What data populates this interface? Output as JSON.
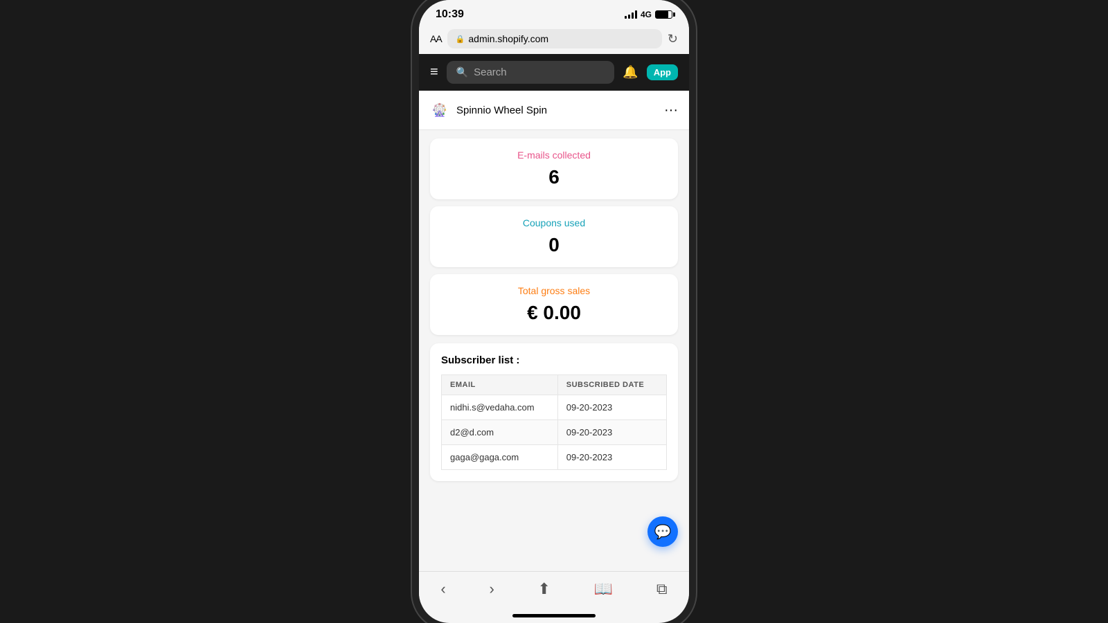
{
  "status_bar": {
    "time": "10:39",
    "network": "4G"
  },
  "browser": {
    "aa_label": "AA",
    "url": "admin.shopify.com",
    "lock_symbol": "🔒"
  },
  "nav": {
    "search_placeholder": "Search",
    "app_badge": "App"
  },
  "app": {
    "name": "Spinnio Wheel Spin",
    "more_dots": "···"
  },
  "stats": {
    "emails_label": "E-mails collected",
    "emails_value": "6",
    "coupons_label": "Coupons used",
    "coupons_value": "0",
    "sales_label": "Total gross sales",
    "sales_value": "€ 0.00"
  },
  "subscribers": {
    "section_title": "Subscriber list :",
    "table": {
      "col_email": "EMAIL",
      "col_date": "SUBSCRIBED DATE",
      "rows": [
        {
          "email": "nidhi.s@vedaha.com",
          "date": "09-20-2023"
        },
        {
          "email": "d2@d.com",
          "date": "09-20-2023"
        },
        {
          "email": "gaga@gaga.com",
          "date": "09-20-2023"
        }
      ]
    }
  },
  "bottom_nav": {
    "back": "‹",
    "forward": "›",
    "share": "⬆",
    "bookmarks": "📖",
    "tabs": "⧉"
  }
}
